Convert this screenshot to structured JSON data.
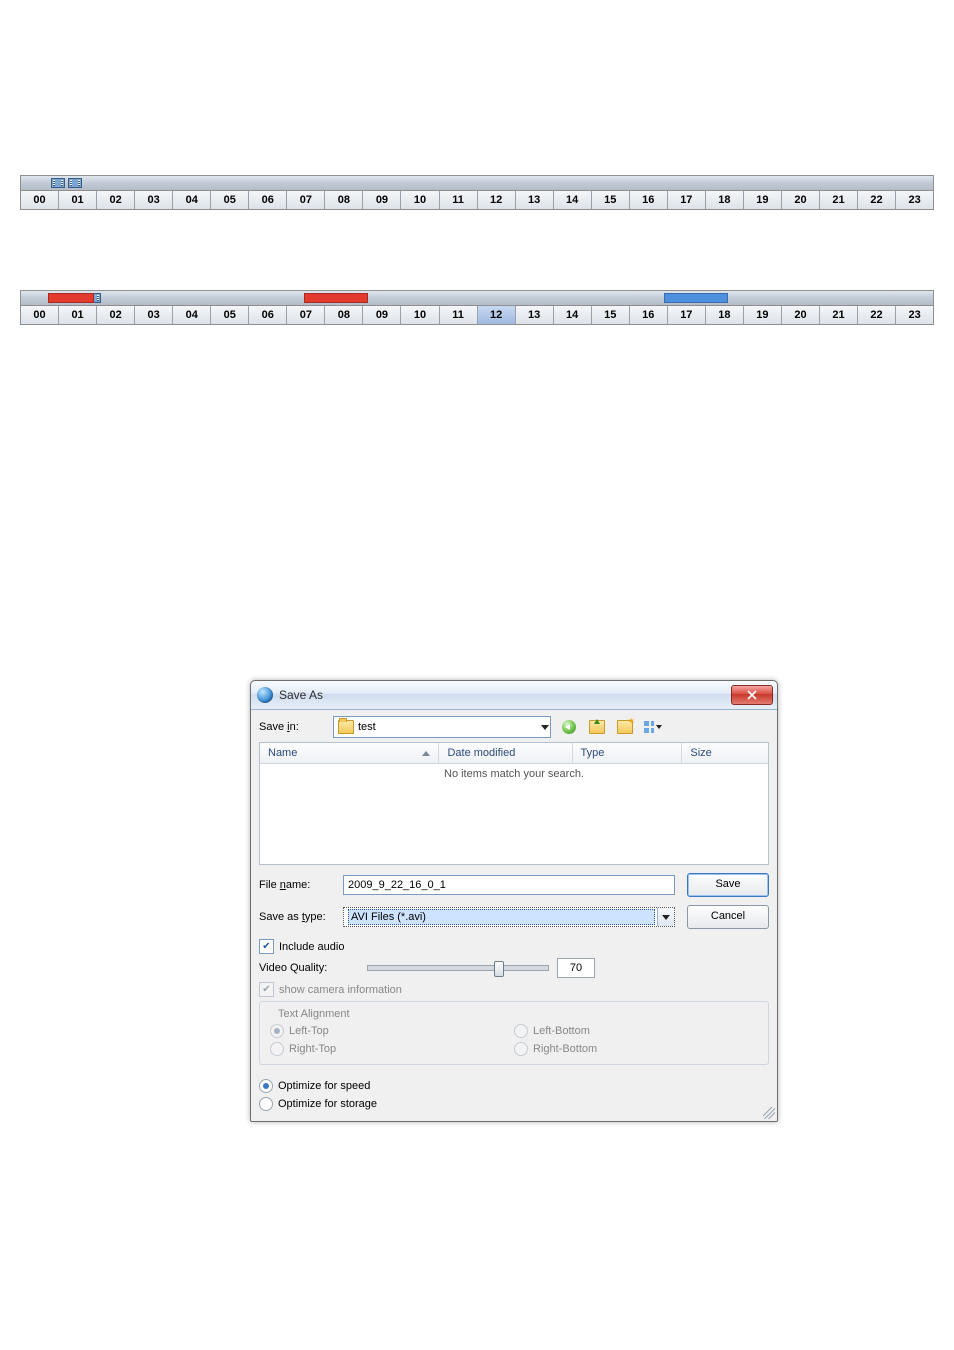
{
  "hours": [
    "00",
    "01",
    "02",
    "03",
    "04",
    "05",
    "06",
    "07",
    "08",
    "09",
    "10",
    "11",
    "12",
    "13",
    "14",
    "15",
    "16",
    "17",
    "18",
    "19",
    "20",
    "21",
    "22",
    "23"
  ],
  "timeline1": {
    "selected_hours": [],
    "icons_percent": [
      3.3,
      5.2
    ],
    "segments": []
  },
  "timeline2": {
    "selected_hours": [
      "12"
    ],
    "icons_percent": [
      5.2,
      7.2
    ],
    "segments": [
      {
        "color": "red",
        "left_pct": 3.0,
        "width_pct": 5.0
      },
      {
        "color": "red",
        "left_pct": 31.0,
        "width_pct": 7.0
      },
      {
        "color": "blue",
        "left_pct": 70.5,
        "width_pct": 7.0
      }
    ]
  },
  "dialog": {
    "title": "Save As",
    "savein_label_pre": "Save ",
    "savein_label_ul": "i",
    "savein_label_post": "n:",
    "savein_value": "test",
    "columns": {
      "name": "Name",
      "date": "Date modified",
      "type": "Type",
      "size": "Size"
    },
    "empty_msg": "No items match your search.",
    "filename_label_pre": "File ",
    "filename_label_ul": "n",
    "filename_label_post": "ame:",
    "filename_value": "2009_9_22_16_0_1",
    "savetype_label_pre": "Save as ",
    "savetype_label_ul": "t",
    "savetype_label_post": "ype:",
    "savetype_value": "AVI Files (*.avi)",
    "save_btn_pre": "",
    "save_btn_ul": "S",
    "save_btn_post": "ave",
    "cancel_btn": "Cancel",
    "include_audio": "Include audio",
    "video_quality_label": "Video Quality:",
    "video_quality_value": "70",
    "show_cam_info": "show camera information",
    "text_alignment_title": "Text Alignment",
    "align": {
      "lt": "Left-Top",
      "lb": "Left-Bottom",
      "rt": "Right-Top",
      "rb": "Right-Bottom"
    },
    "opt_speed": "Optimize for speed",
    "opt_storage": "Optimize for storage"
  }
}
